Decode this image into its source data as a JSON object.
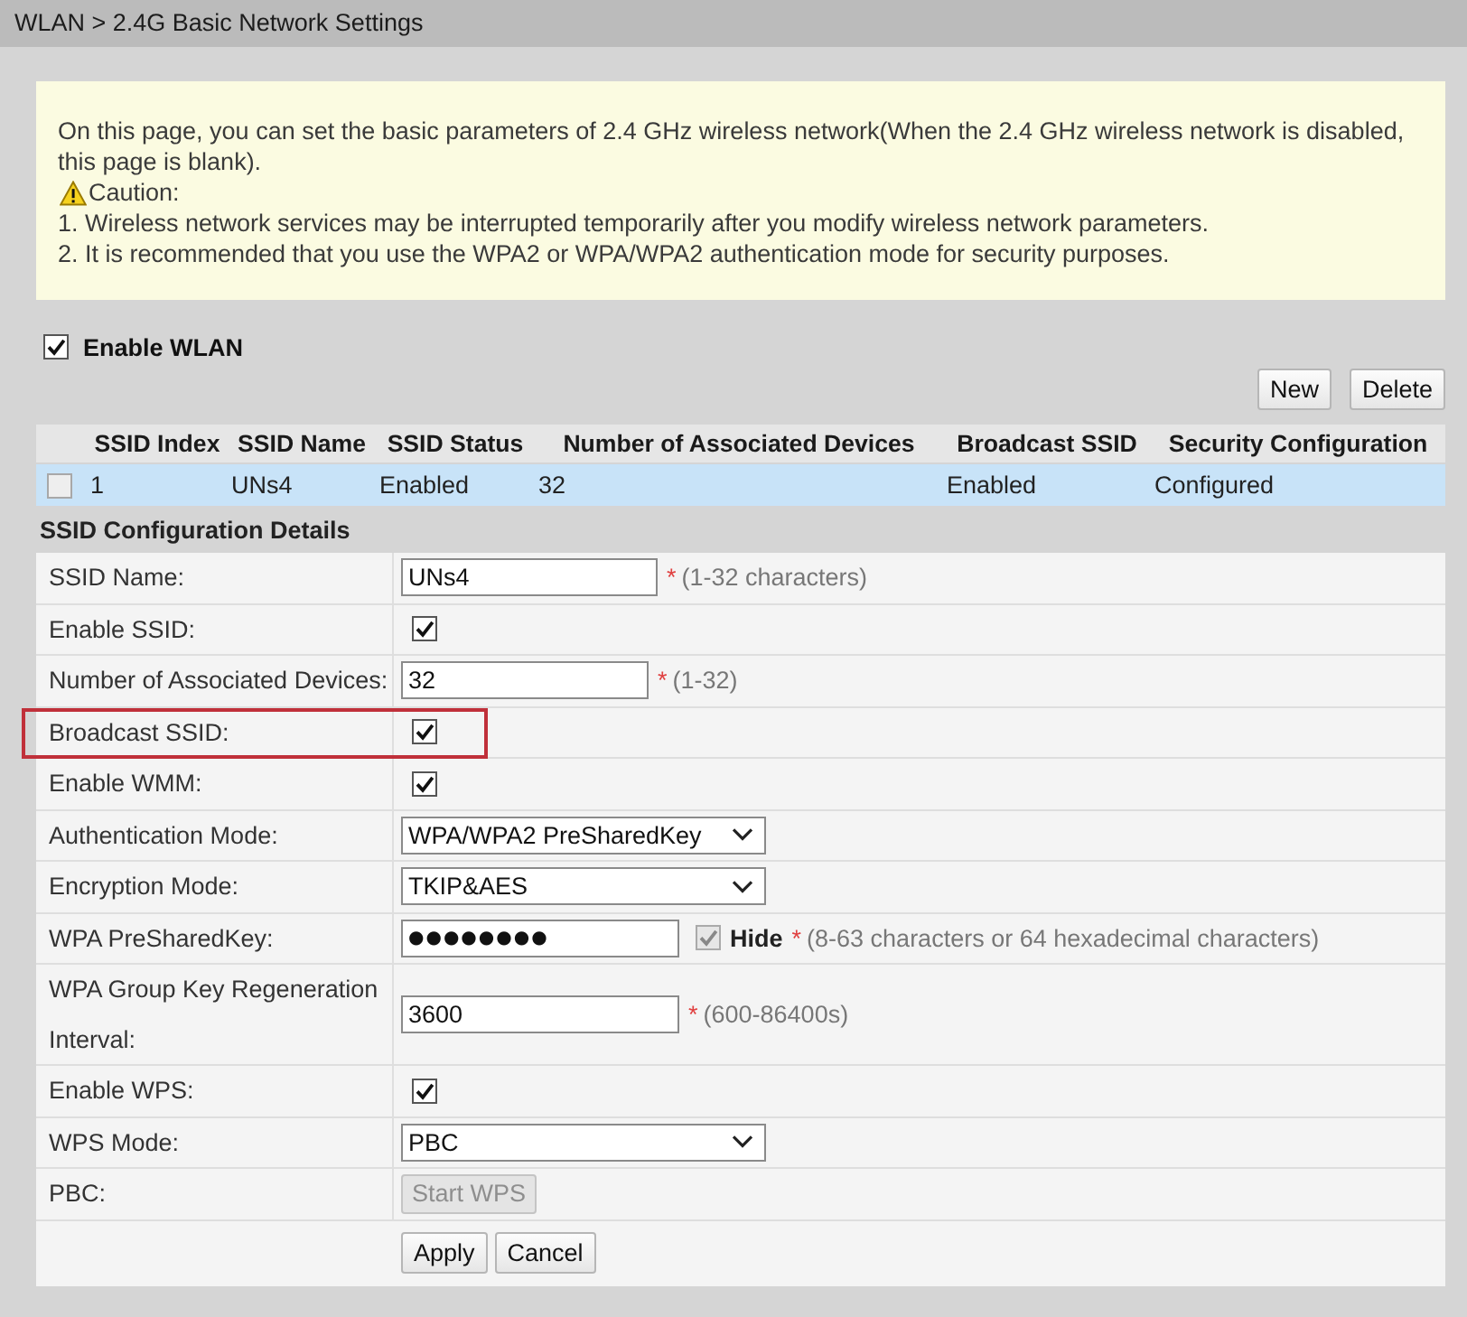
{
  "breadcrumb": "WLAN > 2.4G Basic Network Settings",
  "notice": {
    "intro": "On this page, you can set the basic parameters of 2.4 GHz wireless network(When the 2.4 GHz wireless network is disabled, this page is blank).",
    "caution": "Caution:",
    "items": [
      "1. Wireless network services may be interrupted temporarily after you modify wireless network parameters.",
      "2. It is recommended that you use the WPA2 or WPA/WPA2 authentication mode for security purposes."
    ]
  },
  "enable_wlan": {
    "label": "Enable WLAN",
    "checked": true
  },
  "table_buttons": [
    "New",
    "Delete"
  ],
  "ssid_table": {
    "columns": [
      "SSID Index",
      "SSID Name",
      "SSID Status",
      "Number of Associated Devices",
      "Broadcast SSID",
      "Security Configuration"
    ],
    "rows": [
      {
        "selected": true,
        "checked": false,
        "cells": [
          "1",
          "UNs4",
          "Enabled",
          "32",
          "Enabled",
          "Configured"
        ]
      }
    ]
  },
  "details_title": "SSID Configuration Details",
  "fields": [
    {
      "kind": "text",
      "label": "SSID Name:",
      "value": "UNs4",
      "required_mark": "*",
      "hint": "(1-32 characters)",
      "highlighted": false
    },
    {
      "kind": "checkbox",
      "label": "Enable SSID:",
      "checked": true,
      "highlighted": false
    },
    {
      "kind": "text",
      "label": "Number of Associated Devices:",
      "value": "32",
      "required_mark": "*",
      "hint": "(1-32)",
      "highlighted": false
    },
    {
      "kind": "checkbox",
      "label": "Broadcast SSID:",
      "checked": true,
      "highlighted": true
    },
    {
      "kind": "checkbox",
      "label": "Enable WMM:",
      "checked": true,
      "highlighted": false
    },
    {
      "kind": "select",
      "label": "Authentication Mode:",
      "value": "WPA/WPA2 PreSharedKey",
      "highlighted": false
    },
    {
      "kind": "select",
      "label": "Encryption Mode:",
      "value": "TKIP&AES",
      "highlighted": false
    },
    {
      "kind": "password",
      "label": "WPA PreSharedKey:",
      "value": "●●●●●●●●",
      "hide": {
        "label": "Hide",
        "checked": true,
        "disabled": true
      },
      "required_mark": "*",
      "hint": "(8-63 characters or 64 hexadecimal characters)",
      "highlighted": false
    },
    {
      "kind": "text",
      "label": "WPA Group Key Regeneration Interval:",
      "value": "3600",
      "required_mark": "*",
      "hint": "(600-86400s)",
      "highlighted": false
    },
    {
      "kind": "checkbox",
      "label": "Enable WPS:",
      "checked": true,
      "highlighted": false
    },
    {
      "kind": "select",
      "label": "WPS Mode:",
      "value": "PBC",
      "highlighted": false
    },
    {
      "kind": "button",
      "label": "PBC:",
      "button": "Start WPS",
      "disabled": true,
      "highlighted": false
    }
  ],
  "buttons": [
    "Apply",
    "Cancel"
  ]
}
